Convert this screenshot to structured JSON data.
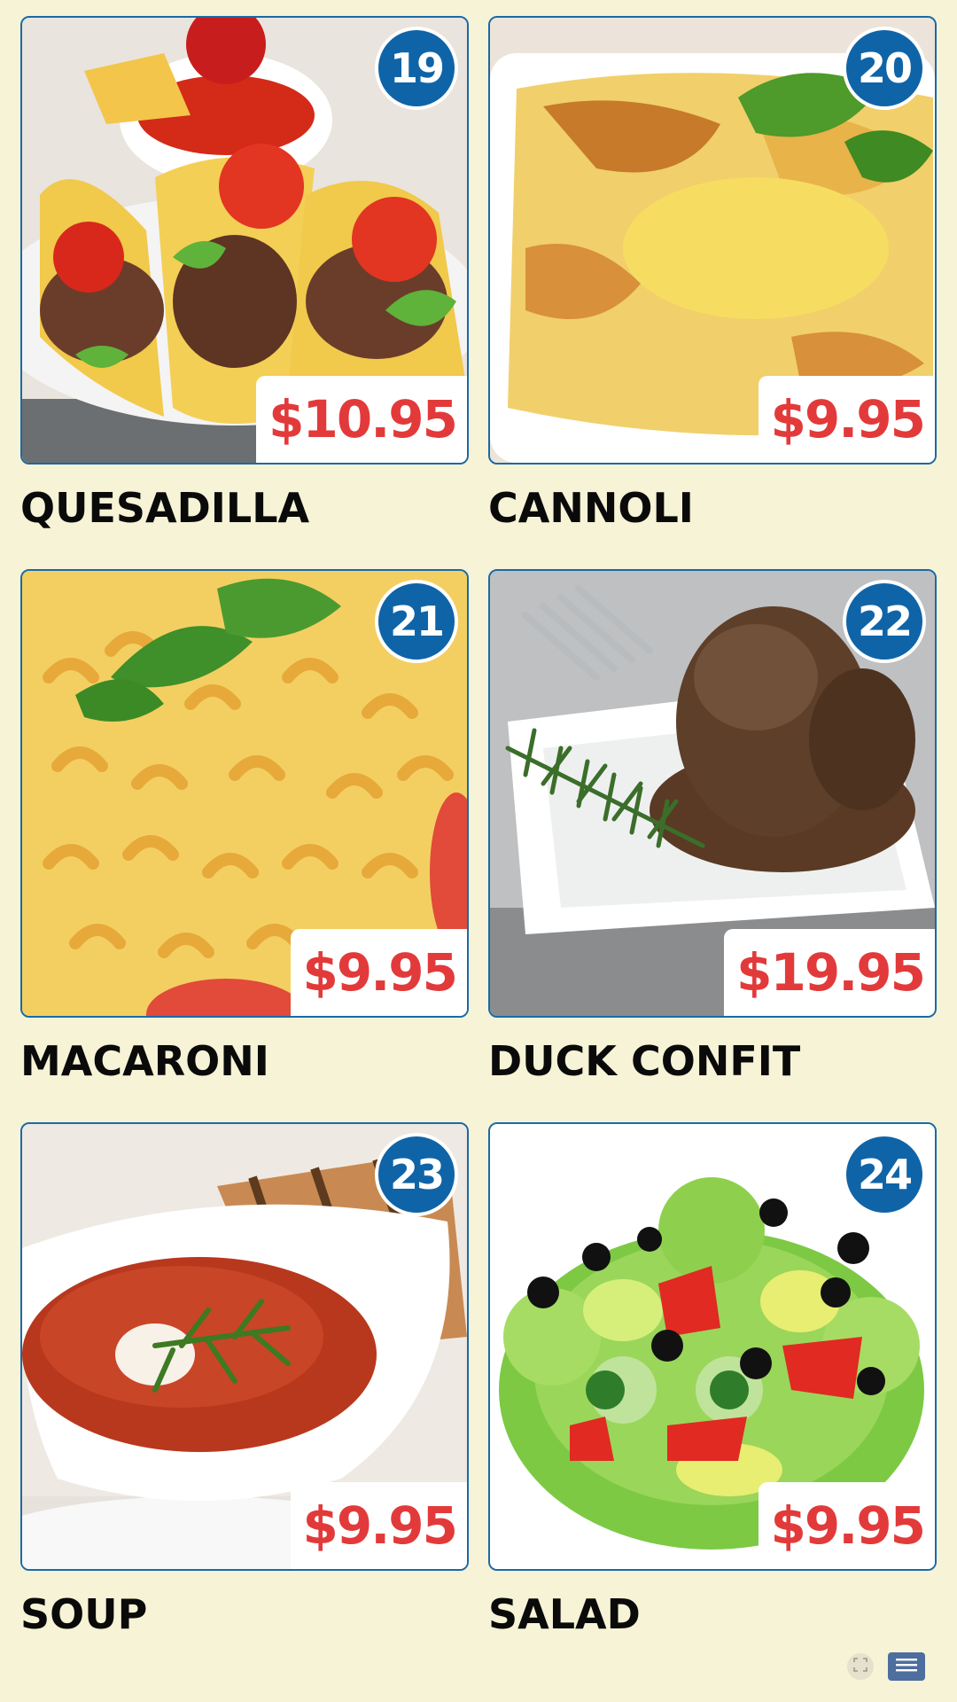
{
  "menu_items": [
    {
      "number": "19",
      "price": "$10.95",
      "name": "QUESADILLA",
      "photo": "tacos-photo"
    },
    {
      "number": "20",
      "price": "$9.95",
      "name": "CANNOLI",
      "photo": "lasagna-photo"
    },
    {
      "number": "21",
      "price": "$9.95",
      "name": "MACARONI",
      "photo": "macaroni-photo"
    },
    {
      "number": "22",
      "price": "$19.95",
      "name": "DUCK CONFIT",
      "photo": "duck-confit-photo"
    },
    {
      "number": "23",
      "price": "$9.95",
      "name": "SOUP",
      "photo": "soup-photo"
    },
    {
      "number": "24",
      "price": "$9.95",
      "name": "SALAD",
      "photo": "salad-photo"
    }
  ],
  "controls": {
    "fullscreen_icon": "fullscreen-icon",
    "menu_icon": "hamburger-menu-icon"
  },
  "colors": {
    "background": "#f6f3d6",
    "badge_blue": "#0f64a8",
    "price_red": "#e23a3a",
    "border_blue": "#1a6aa6"
  }
}
